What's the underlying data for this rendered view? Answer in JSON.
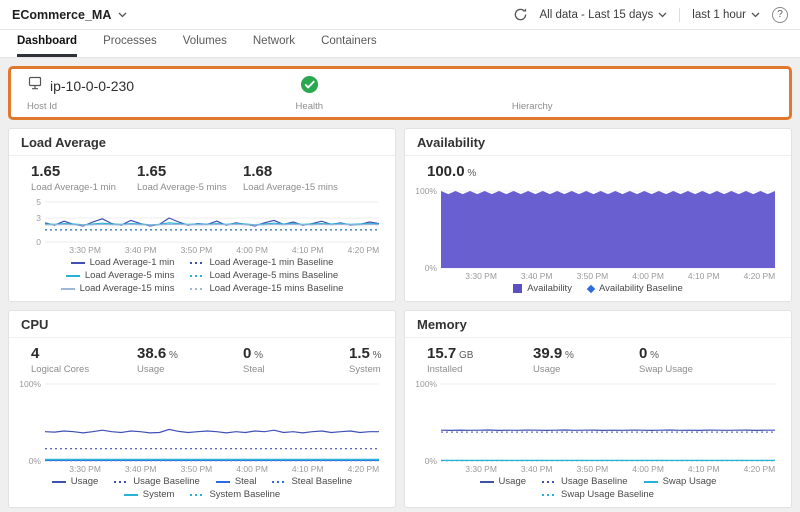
{
  "topbar": {
    "app_name": "ECommerce_MA",
    "data_range": "All data - Last 15 days",
    "time_window": "last 1 hour"
  },
  "tabs": {
    "items": [
      {
        "label": "Dashboard",
        "active": true
      },
      {
        "label": "Processes",
        "active": false
      },
      {
        "label": "Volumes",
        "active": false
      },
      {
        "label": "Network",
        "active": false
      },
      {
        "label": "Containers",
        "active": false
      }
    ]
  },
  "host_card": {
    "host_id_value": "ip-10-0-0-230",
    "host_id_label": "Host Id",
    "health_label": "Health",
    "hierarchy_label": "Hierarchy"
  },
  "panels": {
    "load": {
      "title": "Load Average",
      "stats": [
        {
          "value": "1.65",
          "unit": "",
          "label": "Load Average-1 min"
        },
        {
          "value": "1.65",
          "unit": "",
          "label": "Load Average-5 mins"
        },
        {
          "value": "1.68",
          "unit": "",
          "label": "Load Average-15 mins"
        }
      ],
      "chart": {
        "type": "line",
        "ymin": 0,
        "ymax": 5,
        "yticks": [
          {
            "v": 5,
            "label": "5"
          },
          {
            "v": 3,
            "label": "3"
          },
          {
            "v": 0,
            "label": "0"
          }
        ],
        "xticks": [
          "3:30 PM",
          "3:40 PM",
          "3:50 PM",
          "4:00 PM",
          "4:10 PM",
          "4:20 PM"
        ],
        "series": [
          {
            "name": "Load Average-1 min",
            "color": "#3f51b5",
            "values": [
              2.4,
              2.1,
              2.6,
              2.2,
              2.0,
              2.5,
              2.9,
              2.3,
              2.1,
              2.7,
              2.3,
              2.0,
              2.2,
              3.0,
              2.5,
              2.1,
              2.3,
              2.2,
              2.6,
              2.1,
              2.4,
              2.2,
              2.0,
              2.4,
              2.7,
              2.2,
              2.5,
              2.1,
              2.3,
              2.6,
              2.2,
              2.4,
              2.1,
              2.2,
              2.5,
              2.3
            ]
          },
          {
            "name": "Load Average-1 min Baseline",
            "color": "#3f51b5",
            "dash": "2 3",
            "values": [
              1.55,
              1.55
            ]
          },
          {
            "name": "Load Average-5 mins",
            "color": "#26b3d7",
            "values": [
              2.25,
              2.2,
              2.3,
              2.25,
              2.15,
              2.25,
              2.35,
              2.25,
              2.2,
              2.3,
              2.25,
              2.15,
              2.2,
              2.4,
              2.3,
              2.2,
              2.25,
              2.2,
              2.3,
              2.2,
              2.3,
              2.25,
              2.15,
              2.25,
              2.35,
              2.25,
              2.3,
              2.2,
              2.25,
              2.3,
              2.25,
              2.3,
              2.2,
              2.25,
              2.3,
              2.25
            ]
          },
          {
            "name": "Load Average-5 mins Baseline",
            "color": "#26b3d7",
            "dash": "2 3",
            "values": [
              1.5,
              1.5
            ]
          },
          {
            "name": "Load Average-15 mins",
            "color": "#9fb6d8",
            "values": [
              2.15,
              2.15,
              2.2,
              2.15,
              2.1,
              2.15,
              2.2,
              2.15,
              2.15,
              2.2,
              2.15,
              2.1,
              2.15,
              2.2,
              2.2,
              2.15,
              2.15,
              2.15,
              2.2,
              2.15,
              2.2,
              2.15,
              2.1,
              2.15,
              2.2,
              2.15,
              2.2,
              2.15,
              2.15,
              2.2,
              2.15,
              2.2,
              2.15,
              2.15,
              2.2,
              2.15
            ]
          },
          {
            "name": "Load Average-15 mins Baseline",
            "color": "#9fb6d8",
            "dash": "2 3",
            "values": [
              1.45,
              1.45
            ]
          }
        ]
      },
      "legend": [
        {
          "label": "Load Average-1 min",
          "type": "line",
          "color": "#3f51b5"
        },
        {
          "label": "Load Average-1 min Baseline",
          "type": "dash",
          "color": "#3f51b5"
        },
        {
          "label": "Load Average-5 mins",
          "type": "line",
          "color": "#26b3d7"
        },
        {
          "label": "Load Average-5 mins Baseline",
          "type": "dash",
          "color": "#26b3d7"
        },
        {
          "label": "Load Average-15 mins",
          "type": "line",
          "color": "#9fb6d8"
        },
        {
          "label": "Load Average-15 mins Baseline",
          "type": "dash",
          "color": "#9fb6d8"
        }
      ]
    },
    "availability": {
      "title": "Availability",
      "stats": [
        {
          "value": "100.0",
          "unit": "%",
          "label": ""
        }
      ],
      "chart": {
        "type": "area",
        "ymin": 0,
        "ymax": 100,
        "yticks": [
          {
            "v": 100,
            "label": "100%"
          },
          {
            "v": 0,
            "label": "0%"
          }
        ],
        "xticks": [
          "3:30 PM",
          "3:40 PM",
          "3:50 PM",
          "4:00 PM",
          "4:10 PM",
          "4:20 PM"
        ],
        "series": [
          {
            "name": "Availability",
            "type": "area",
            "color": "#6a5fd0",
            "values": [
              100,
              96,
              100,
              96,
              100,
              96,
              100,
              96,
              100,
              96,
              100,
              96,
              100,
              96,
              100,
              96,
              100,
              96,
              100,
              96,
              100,
              96,
              100,
              96,
              100,
              96,
              100,
              96,
              100,
              96,
              100,
              96,
              100,
              96,
              100,
              96,
              100,
              96,
              100,
              96,
              100,
              96,
              100,
              96,
              100,
              96,
              100
            ]
          }
        ]
      },
      "legend": [
        {
          "label": "Availability",
          "type": "square",
          "color": "#5b50c0"
        },
        {
          "label": "Availability Baseline",
          "type": "diamond",
          "color": "#2d6be0"
        }
      ]
    },
    "cpu": {
      "title": "CPU",
      "stats": [
        {
          "value": "4",
          "unit": "",
          "label": "Logical Cores"
        },
        {
          "value": "38.6",
          "unit": "%",
          "label": "Usage"
        },
        {
          "value": "0",
          "unit": "%",
          "label": "Steal"
        },
        {
          "value": "1.5",
          "unit": "%",
          "label": "System"
        }
      ],
      "chart": {
        "type": "line",
        "ymin": 0,
        "ymax": 100,
        "yticks": [
          {
            "v": 100,
            "label": "100%"
          },
          {
            "v": 0,
            "label": "0%"
          }
        ],
        "xticks": [
          "3:30 PM",
          "3:40 PM",
          "3:50 PM",
          "4:00 PM",
          "4:10 PM",
          "4:20 PM"
        ],
        "series": [
          {
            "name": "Usage",
            "color": "#3f51b5",
            "values": [
              38,
              37.5,
              39,
              38,
              36.5,
              38,
              40,
              38,
              37,
              39,
              38,
              36.5,
              37,
              41,
              38.5,
              37,
              38,
              39,
              38,
              36.5,
              38,
              37,
              39,
              38,
              40,
              37,
              38,
              36.5,
              38,
              39,
              37,
              38,
              39,
              37,
              38,
              38
            ]
          },
          {
            "name": "Usage Baseline",
            "color": "#3f51b5",
            "dash": "2 3",
            "values": [
              16,
              16
            ]
          },
          {
            "name": "Steal",
            "color": "#2d6be0",
            "values": [
              0.8,
              0.8
            ]
          },
          {
            "name": "Steal Baseline",
            "color": "#2d6be0",
            "dash": "2 3",
            "values": [
              0.4,
              0.4
            ]
          },
          {
            "name": "System",
            "color": "#26b3d7",
            "values": [
              2.2,
              2.2
            ]
          },
          {
            "name": "System Baseline",
            "color": "#26b3d7",
            "dash": "2 3",
            "values": [
              1.3,
              1.3
            ]
          }
        ]
      },
      "legend": [
        {
          "label": "Usage",
          "type": "line",
          "color": "#3f51b5"
        },
        {
          "label": "Usage Baseline",
          "type": "dash",
          "color": "#3f51b5"
        },
        {
          "label": "Steal",
          "type": "line",
          "color": "#2d6be0"
        },
        {
          "label": "Steal Baseline",
          "type": "dash",
          "color": "#2d6be0"
        },
        {
          "label": "System",
          "type": "line",
          "color": "#26b3d7"
        },
        {
          "label": "System Baseline",
          "type": "dash",
          "color": "#26b3d7"
        }
      ]
    },
    "memory": {
      "title": "Memory",
      "stats": [
        {
          "value": "15.7",
          "unit": "GB",
          "label": "Installed"
        },
        {
          "value": "39.9",
          "unit": "%",
          "label": "Usage"
        },
        {
          "value": "0",
          "unit": "%",
          "label": "Swap Usage"
        }
      ],
      "chart": {
        "type": "line",
        "ymin": 0,
        "ymax": 100,
        "yticks": [
          {
            "v": 100,
            "label": "100%"
          },
          {
            "v": 0,
            "label": "0%"
          }
        ],
        "xticks": [
          "3:30 PM",
          "3:40 PM",
          "3:50 PM",
          "4:00 PM",
          "4:10 PM",
          "4:20 PM"
        ],
        "series": [
          {
            "name": "Usage",
            "color": "#3f51b5",
            "values": [
              40,
              39.8,
              40.1,
              39.9,
              40,
              40.2,
              39.8,
              40,
              39.9,
              40.1,
              40,
              39.8,
              40,
              40.2,
              39.9,
              40,
              40.1,
              39.8,
              40,
              39.9,
              40.1,
              40,
              39.8,
              40,
              40.2,
              39.9,
              40,
              39.8,
              40.1,
              40,
              39.9,
              40,
              40.1,
              39.8,
              40,
              40
            ]
          },
          {
            "name": "Usage Baseline",
            "color": "#6a74c9",
            "dash": "2 3",
            "values": [
              37.5,
              37.5
            ]
          },
          {
            "name": "Swap Usage",
            "color": "#26b3d7",
            "values": [
              0.8,
              0.8
            ]
          },
          {
            "name": "Swap Usage Baseline",
            "color": "#26b3d7",
            "dash": "2 3",
            "values": [
              0.4,
              0.4
            ]
          }
        ]
      },
      "legend": [
        {
          "label": "Usage",
          "type": "line",
          "color": "#3f51b5"
        },
        {
          "label": "Usage Baseline",
          "type": "dash",
          "color": "#3f51b5"
        },
        {
          "label": "Swap Usage",
          "type": "line",
          "color": "#26b3d7"
        },
        {
          "label": "Swap Usage Baseline",
          "type": "dash",
          "color": "#26b3d7"
        }
      ]
    }
  }
}
